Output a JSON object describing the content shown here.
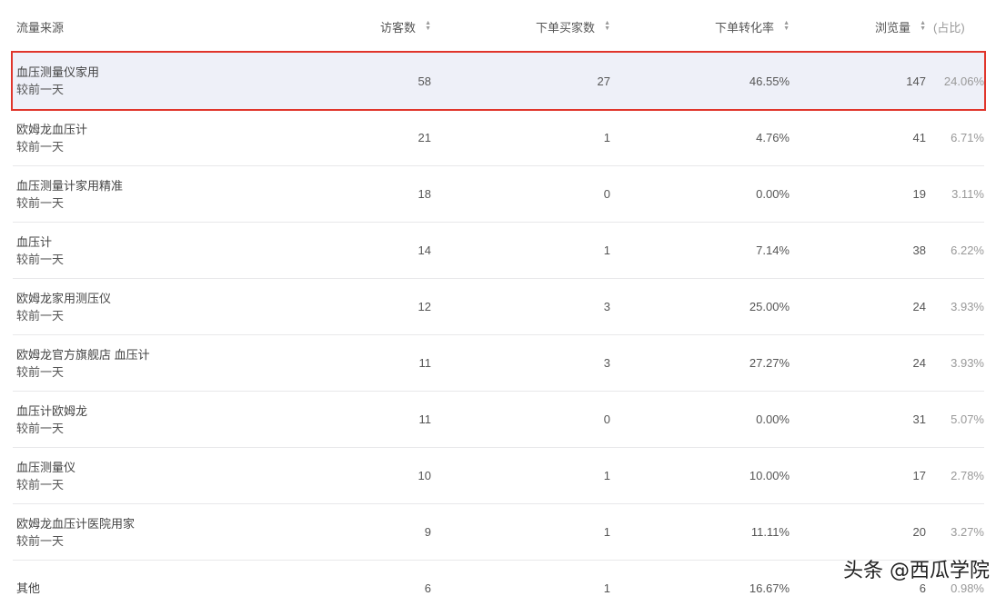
{
  "header": {
    "source": "流量来源",
    "visitors": "访客数",
    "buyers": "下单买家数",
    "rate": "下单转化率",
    "views": "浏览量",
    "share": "(占比)"
  },
  "rows": [
    {
      "name": "血压测量仪家用",
      "sub": "较前一天",
      "visitors": "58",
      "buyers": "27",
      "rate": "46.55%",
      "views": "147",
      "share": "24.06%"
    },
    {
      "name": "欧姆龙血压计",
      "sub": "较前一天",
      "visitors": "21",
      "buyers": "1",
      "rate": "4.76%",
      "views": "41",
      "share": "6.71%"
    },
    {
      "name": "血压测量计家用精准",
      "sub": "较前一天",
      "visitors": "18",
      "buyers": "0",
      "rate": "0.00%",
      "views": "19",
      "share": "3.11%"
    },
    {
      "name": "血压计",
      "sub": "较前一天",
      "visitors": "14",
      "buyers": "1",
      "rate": "7.14%",
      "views": "38",
      "share": "6.22%"
    },
    {
      "name": "欧姆龙家用测压仪",
      "sub": "较前一天",
      "visitors": "12",
      "buyers": "3",
      "rate": "25.00%",
      "views": "24",
      "share": "3.93%"
    },
    {
      "name": "欧姆龙官方旗舰店 血压计",
      "sub": "较前一天",
      "visitors": "11",
      "buyers": "3",
      "rate": "27.27%",
      "views": "24",
      "share": "3.93%"
    },
    {
      "name": "血压计欧姆龙",
      "sub": "较前一天",
      "visitors": "11",
      "buyers": "0",
      "rate": "0.00%",
      "views": "31",
      "share": "5.07%"
    },
    {
      "name": "血压测量仪",
      "sub": "较前一天",
      "visitors": "10",
      "buyers": "1",
      "rate": "10.00%",
      "views": "17",
      "share": "2.78%"
    },
    {
      "name": "欧姆龙血压计医院用家",
      "sub": "较前一天",
      "visitors": "9",
      "buyers": "1",
      "rate": "11.11%",
      "views": "20",
      "share": "3.27%"
    },
    {
      "name": "其他",
      "sub": "",
      "visitors": "6",
      "buyers": "1",
      "rate": "16.67%",
      "views": "6",
      "share": "0.98%"
    }
  ],
  "watermark": "头条 @西瓜学院",
  "colors": {
    "highlight_border": "#e0352b",
    "highlight_bg": "#eef0f8"
  }
}
